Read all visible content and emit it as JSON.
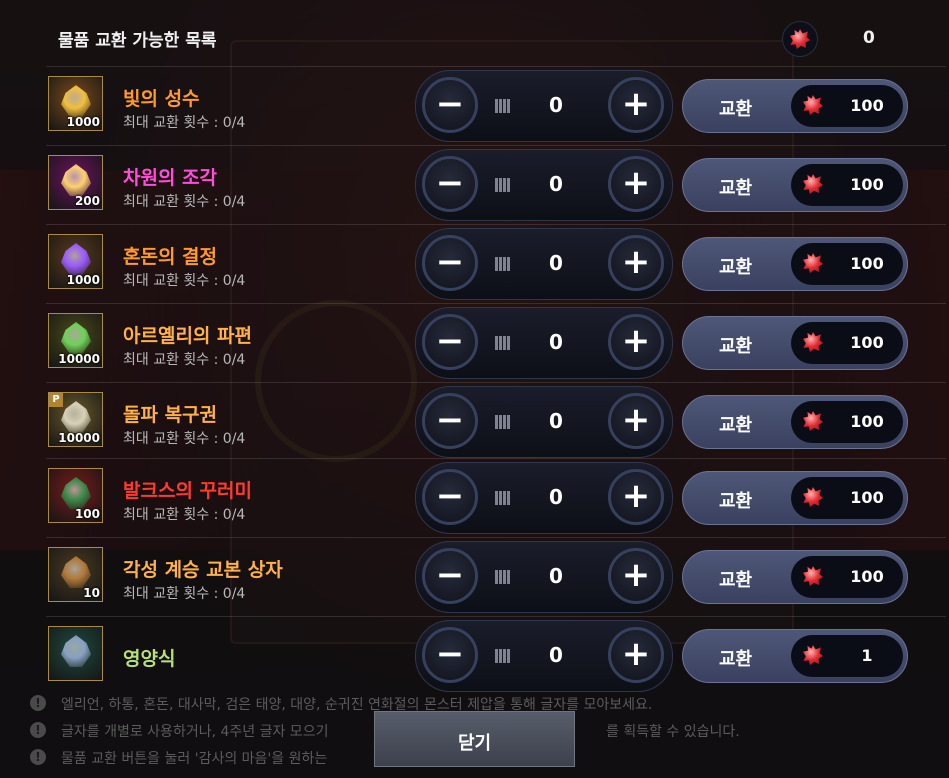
{
  "header": {
    "title": "물품 교환 가능한 목록",
    "currency_count": "0",
    "currency_icon": "gift-gem-icon"
  },
  "colors": {
    "orange": "#ff9a2e",
    "pink": "#ff4fd8",
    "red": "#ff3b30",
    "green": "#b7e07a"
  },
  "items": [
    {
      "name": "빛의 성수",
      "color": "#ff9a2e",
      "limit": "최대 교환 횟수 : 0/4",
      "qty": "1000",
      "quantity": "0",
      "price": "100",
      "icon": "holy-water-icon",
      "frame_bg": "#7a4a1a",
      "badge": ""
    },
    {
      "name": "차원의 조각",
      "color": "#ff4fd8",
      "limit": "최대 교환 횟수 : 0/4",
      "qty": "200",
      "quantity": "0",
      "price": "100",
      "icon": "dimension-fragment-icon",
      "frame_bg": "#6a1460",
      "badge": ""
    },
    {
      "name": "혼돈의 결정",
      "color": "#ff9a2e",
      "limit": "최대 교환 횟수 : 0/4",
      "qty": "1000",
      "quantity": "0",
      "price": "100",
      "icon": "chaos-crystal-icon",
      "frame_bg": "#5a3a1a",
      "badge": ""
    },
    {
      "name": "아르옐리의 파편",
      "color": "#ffb14a",
      "limit": "최대 교환 횟수 : 0/4",
      "qty": "10000",
      "quantity": "0",
      "price": "100",
      "icon": "fragment-icon",
      "frame_bg": "#4a4a18",
      "badge": ""
    },
    {
      "name": "돌파 복구권",
      "color": "#ffb14a",
      "limit": "최대 교환 횟수 : 0/4",
      "qty": "10000",
      "quantity": "0",
      "price": "100",
      "icon": "scroll-icon",
      "frame_bg": "#6a5a2a",
      "badge": "P"
    },
    {
      "name": "발크스의 꾸러미",
      "color": "#ff3b30",
      "limit": "최대 교환 횟수 : 0/4",
      "qty": "100",
      "quantity": "0",
      "price": "100",
      "icon": "bundle-icon",
      "frame_bg": "#7a1a1a",
      "badge": ""
    },
    {
      "name": "각성 계승 교본 상자",
      "color": "#ffb14a",
      "limit": "최대 교환 횟수 : 0/4",
      "qty": "10",
      "quantity": "0",
      "price": "100",
      "icon": "chest-icon",
      "frame_bg": "#4a3a22",
      "badge": ""
    },
    {
      "name": "영양식",
      "color": "#b7e07a",
      "limit": "",
      "qty": "",
      "quantity": "0",
      "price": "1",
      "icon": "food-bowl-icon",
      "frame_bg": "#1f4a3e",
      "badge": ""
    }
  ],
  "labels": {
    "exchange": "교환",
    "close": "닫기"
  },
  "notes": [
    "엘리언, 하통, 혼돈, 대사막, 검은 태양, 대양, 순귀진 연화절의 몬스터 제압을 통해 글자를 모아보세요.",
    "글자를 개별로 사용하거나, 4주년 글자 모으기",
    "물품 교환 버튼을 눌러 '감사의 마음'을 원하는"
  ],
  "notes_tail": [
    "",
    "를 획득할 수 있습니다.",
    ""
  ]
}
